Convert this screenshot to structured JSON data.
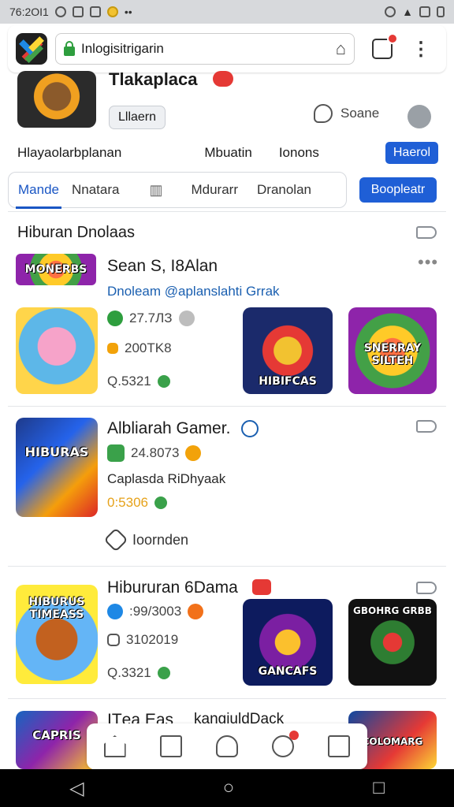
{
  "status_bar": {
    "time": "76:2ОІ1"
  },
  "browser": {
    "url": "Inlogisitrigarin"
  },
  "header": {
    "title": "Tlakaplaca",
    "chip": "Lllaern",
    "search_label": "Soane"
  },
  "nav1": {
    "items": [
      "Hlayaolarbplanan",
      "Mbuatin",
      "Ionons"
    ],
    "button": "Haerol"
  },
  "nav2": {
    "tabs": [
      "Mande",
      "Nnatara",
      "Mdurarr",
      "Dranolan"
    ],
    "button": "Boopleatr"
  },
  "section": {
    "title": "Hiburan Dnolaas"
  },
  "cards": [
    {
      "title": "Sean S, I8Alan",
      "subtitle": "Dnoleam @aplanslahti Grrak",
      "stats": [
        "27.7ЛЗ",
        "200TK8",
        "Q.5321"
      ],
      "thumb_labels": [
        "MONERBS",
        "HIBIFCAS",
        "SNERRAY SILTEH"
      ]
    },
    {
      "title": "Albliarah Gamer.",
      "subtitle": "Caplasda RiDhyaak",
      "stats": [
        "24.8073",
        "0:5306"
      ],
      "thumb_labels": [
        "HIBURAS"
      ],
      "recommend": "Ioornden"
    },
    {
      "title": "Hibururan 6Dama",
      "stats": [
        ":99/3003",
        "3102019",
        "Q.3321"
      ],
      "thumb_labels": [
        "HIBURUS TIMEASS",
        "GANCAFS",
        "GBOHRG GRBB"
      ]
    },
    {
      "title": "IТea Eas",
      "title_extra": "kangiuldDack",
      "thumb_labels": [
        "CAPRIS",
        "COLOMARG"
      ]
    }
  ],
  "colors": {
    "accent": "#1f5fd6",
    "link": "#1a5fb0",
    "badge": "#e53935",
    "green": "#2e9e3e"
  }
}
